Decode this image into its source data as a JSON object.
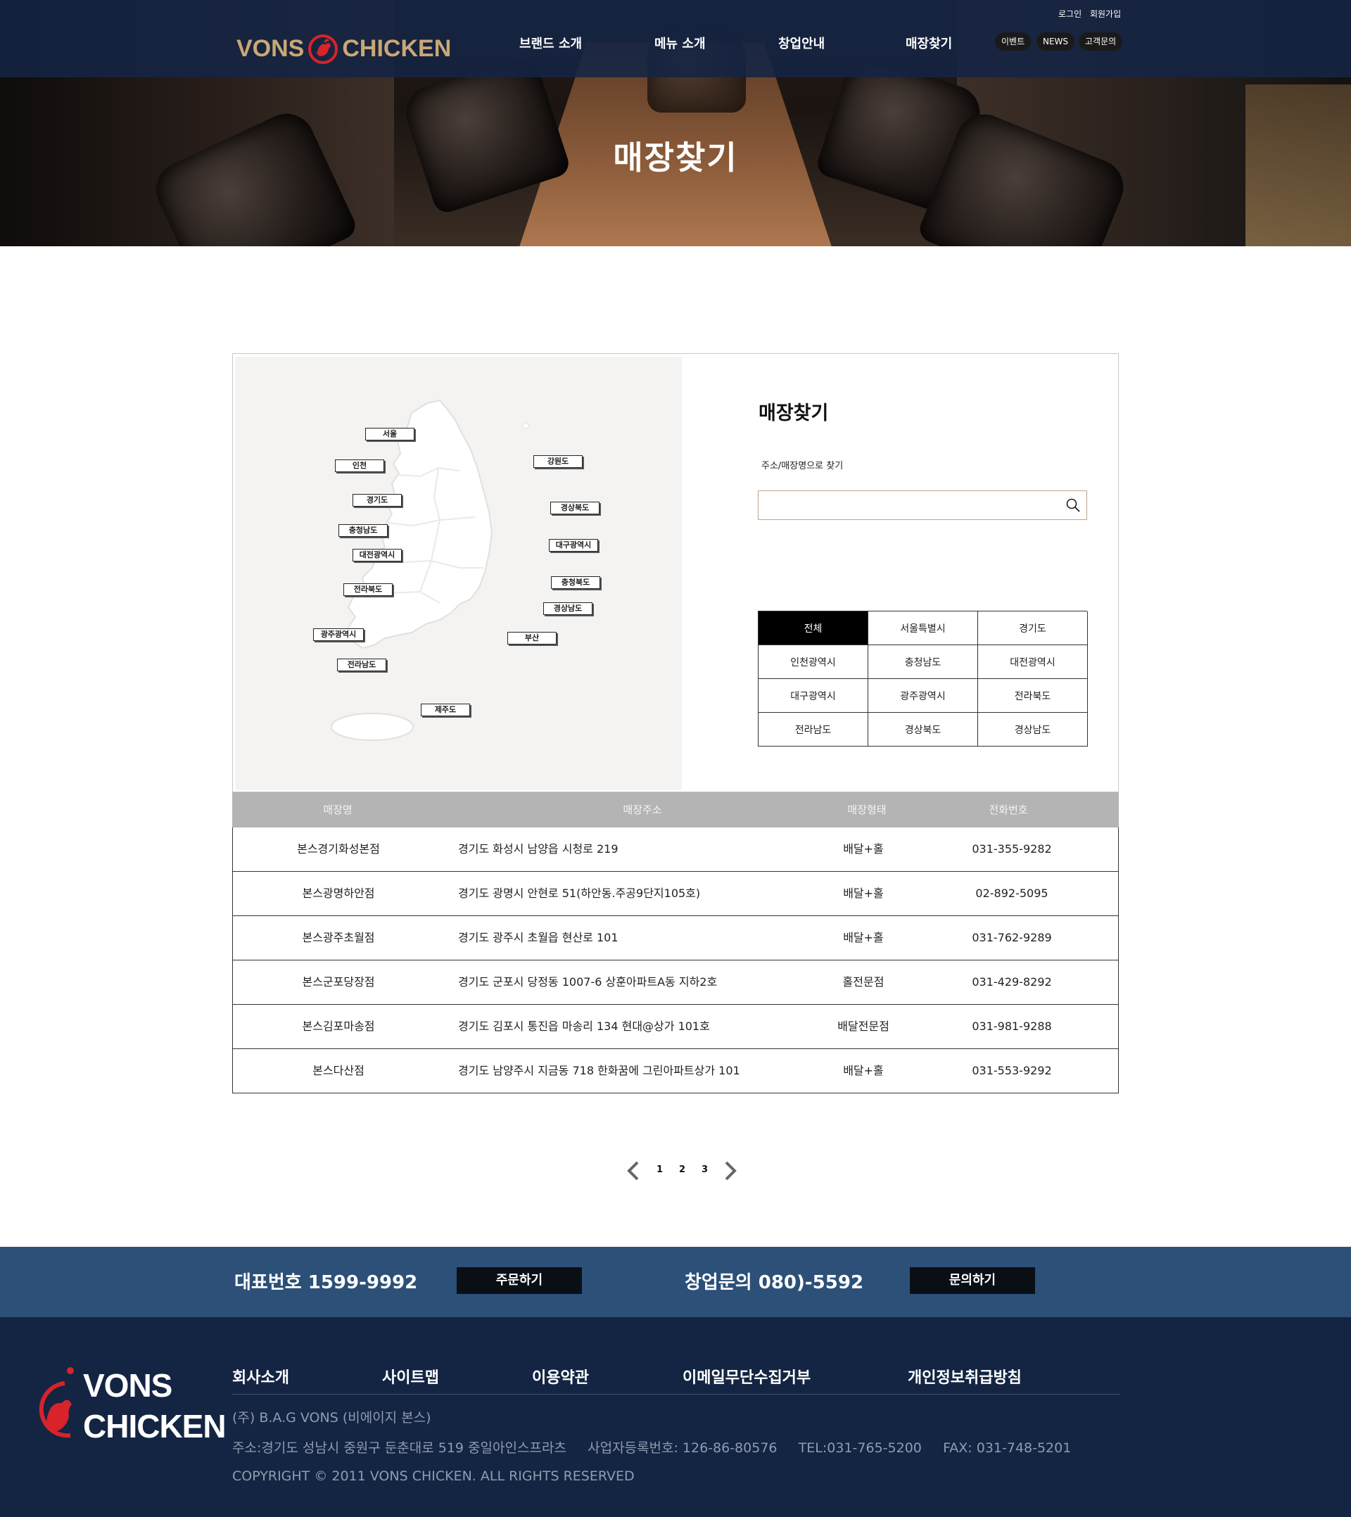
{
  "header": {
    "logo_left": "VONS",
    "logo_right": "CHICKEN",
    "top_links": [
      "로그인",
      "회원가입"
    ],
    "nav": [
      "브랜드 소개",
      "메뉴 소개",
      "창업안내",
      "매장찾기"
    ],
    "pills": [
      "이벤트",
      "NEWS",
      "고객문의"
    ]
  },
  "hero": {
    "title": "매장찾기"
  },
  "finder": {
    "title": "매장찾기",
    "search_label": "주소/매장명으로 찾기",
    "search_placeholder": "",
    "map_regions": [
      "서울",
      "인천",
      "강원도",
      "경기도",
      "경상북도",
      "충청남도",
      "대전광역시",
      "대구광역시",
      "전라북도",
      "충청북도",
      "경상남도",
      "광주광역시",
      "부산",
      "전라남도",
      "제주도"
    ],
    "region_buttons": [
      "전체",
      "서울특별시",
      "경기도",
      "인천광역시",
      "충청남도",
      "대전광역시",
      "대구광역시",
      "광주광역시",
      "전라북도",
      "전라남도",
      "경상북도",
      "경상남도"
    ],
    "active_region": "전체"
  },
  "table": {
    "headers": [
      "매장명",
      "매장주소",
      "매장형태",
      "전화번호"
    ],
    "rows": [
      [
        "본스경기화성본점",
        "경기도 화성시 남양읍 시청로 219",
        "배달+홀",
        "031-355-9282"
      ],
      [
        "본스광명하안점",
        "경기도 광명시 안현로 51(하안동.주공9단지105호)",
        "배달+홀",
        "02-892-5095"
      ],
      [
        "본스광주초월점",
        "경기도 광주시 초월읍 현산로 101",
        "배달+홀",
        "031-762-9289"
      ],
      [
        "본스군포당장점",
        "경기도 군포시 당정동 1007-6 상훈아파트A동 지하2호",
        "홀전문점",
        "031-429-8292"
      ],
      [
        "본스김포마송점",
        "경기도 김포시 통진읍 마송리 134 현대@상가 101호",
        "배달전문점",
        "031-981-9288"
      ],
      [
        "본스다산점",
        "경기도 남양주시 지금동 718 한화꿈에 그린아파트상가 101",
        "배달+홀",
        "031-553-9292"
      ]
    ]
  },
  "pagination": {
    "pages": [
      "1",
      "2",
      "3"
    ]
  },
  "contact": {
    "main_tel": "대표번호 1599-9992",
    "order_button": "주문하기",
    "startup_tel": "창업문의 080)-5592",
    "inquiry_button": "문의하기"
  },
  "footer": {
    "logo_top": "VONS",
    "logo_bottom": "CHICKEN",
    "links": [
      "회사소개",
      "사이트맵",
      "이용약관",
      "이메일무단수집거부",
      "개인정보취급방침"
    ],
    "company": "(주) B.A.G VONS (비에이지 본스)",
    "address_line": "주소:경기도 성남시 중원구 둔춘대로 519 중일아인스프라츠     사업자등록번호: 126-86-80576     TEL:031-765-5200     FAX: 031-748-5201",
    "copyright": "COPYRIGHT © 2011 VONS CHICKEN. ALL RIGHTS RESERVED"
  },
  "colors": {
    "header_bg": "#142444",
    "contact_bar": "#2c5078",
    "footer_bg": "#142543",
    "logo_gold": "#c9a876",
    "logo_red": "#d8232a",
    "table_header": "#b4b4b4"
  }
}
